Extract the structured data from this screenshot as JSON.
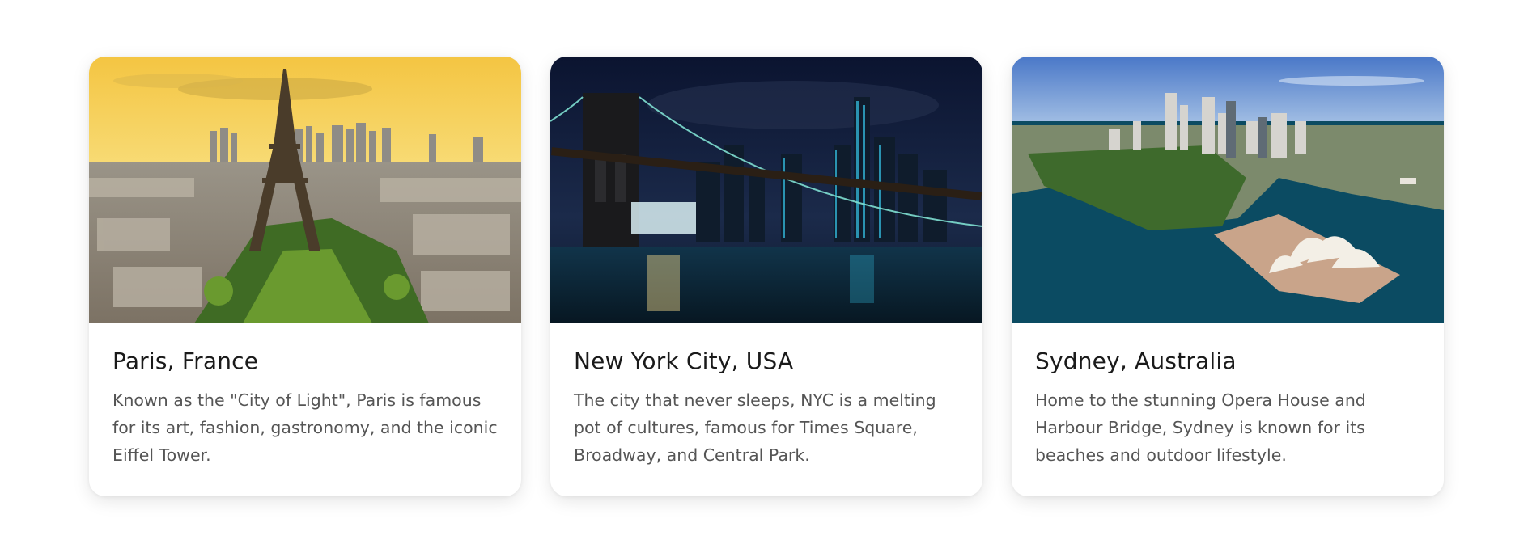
{
  "cards": [
    {
      "title": "Paris, France",
      "description": "Known as the \"City of Light\", Paris is famous for its art, fashion, gastronomy, and the iconic Eiffel Tower.",
      "image": "eiffel-tower-paris-skyline-photo"
    },
    {
      "title": "New York City, USA",
      "description": "The city that never sleeps, NYC is a melting pot of cultures, famous for Times Square, Broadway, and Central Park.",
      "image": "brooklyn-bridge-night-skyline-photo"
    },
    {
      "title": "Sydney, Australia",
      "description": "Home to the stunning Opera House and Harbour Bridge, Sydney is known for its beaches and outdoor lifestyle.",
      "image": "sydney-opera-house-harbour-photo"
    }
  ]
}
